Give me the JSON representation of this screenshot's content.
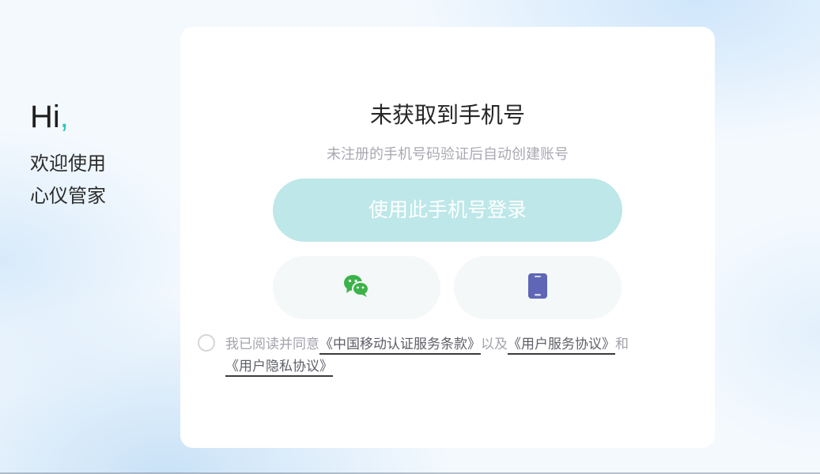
{
  "welcome": {
    "hi": "Hi",
    "comma": ",",
    "line1": "欢迎使用",
    "line2": "心仪管家"
  },
  "card": {
    "title": "未获取到手机号",
    "subtitle": "未注册的手机号码验证后自动创建账号",
    "login_button": "使用此手机号登录",
    "alt_buttons": {
      "wechat_icon": "wechat-icon",
      "phone_icon": "phone-icon"
    },
    "agreement": {
      "prefix": "我已阅读并同意",
      "link1": "《中国移动认证服务条款》",
      "middle": "以及",
      "link2": "《用户服务协议》",
      "and": "和",
      "link3": "《用户隐私协议》"
    }
  },
  "colors": {
    "accent": "#2ec6bf",
    "login_button_bg": "#bde7e9",
    "wechat_green": "#3cb24a",
    "phone_purple": "#5f66b6"
  }
}
